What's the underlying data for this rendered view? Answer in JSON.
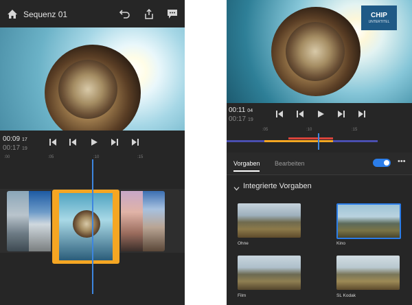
{
  "left": {
    "title": "Sequenz 01",
    "timecode_current": {
      "main": "00:09",
      "frames": "17"
    },
    "timecode_total": {
      "main": "00:17",
      "frames": "19"
    },
    "ruler": [
      ":00",
      ":05",
      ":10",
      ":15"
    ],
    "icons": [
      "home-icon",
      "undo-icon",
      "share-icon",
      "comment-icon",
      "skip-start-icon",
      "step-back-icon",
      "play-icon",
      "step-forward-icon",
      "skip-end-icon"
    ],
    "colors": {
      "selection": "#f5a623",
      "playhead": "#3d86e0"
    }
  },
  "right": {
    "watermark": {
      "brand": "CHIP",
      "sub": "UNTERTITEL"
    },
    "timecode_current": {
      "main": "00:11",
      "frames": "04"
    },
    "timecode_total": {
      "main": "00:17",
      "frames": "19"
    },
    "ruler": [
      ":05",
      ":10",
      ":15"
    ],
    "tabs": [
      {
        "label": "Vorgaben",
        "active": true
      },
      {
        "label": "Bearbeiten",
        "active": false
      }
    ],
    "toggle_on": true,
    "section_title": "Integrierte Vorgaben",
    "presets": [
      {
        "label": "Ohne",
        "selected": false
      },
      {
        "label": "Kino",
        "selected": true
      },
      {
        "label": "Film",
        "selected": false
      },
      {
        "label": "SL Kodak",
        "selected": false
      }
    ],
    "colors": {
      "accent": "#2b7de9",
      "track_blue": "#4a4fb0",
      "track_orange": "#f5a623",
      "track_red": "#d9433a",
      "watermark_bg": "#1f5a86"
    }
  }
}
